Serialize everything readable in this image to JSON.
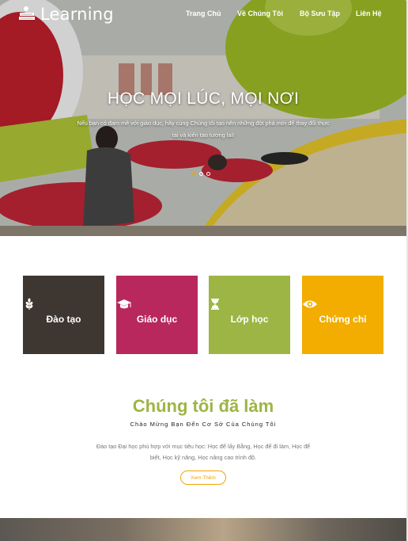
{
  "brand": {
    "name": "Learning"
  },
  "nav": {
    "items": [
      "Trang Chủ",
      "Về Chúng Tôi",
      "Bộ Sưu Tập",
      "Liên Hệ"
    ]
  },
  "hero": {
    "title": "HỌC MỌI LÚC, MỌI NƠI",
    "subtitle_line1": "Nếu bạn có đam mê với giáo dục, hãy cùng Chúng tôi tạo nên những đột phá mới để thay đổi thực",
    "subtitle_line2": "tại và kiến tạo tương lai!",
    "slide_count": 3,
    "active_slide": 1
  },
  "features": [
    {
      "label": "Đào tạo",
      "icon": "wheat-icon",
      "color": "#3e3631"
    },
    {
      "label": "Giáo dục",
      "icon": "graduation-cap-icon",
      "color": "#b8285c"
    },
    {
      "label": "Lớp học",
      "icon": "hourglass-icon",
      "color": "#9db544"
    },
    {
      "label": "Chứng chỉ",
      "icon": "eye-icon",
      "color": "#f2ad00"
    }
  ],
  "about": {
    "title": "Chúng tôi đã làm",
    "subtitle": "Chào Mừng Bạn Đến Cơ Sở Của Chúng Tôi",
    "text_line1": "Đào tạo Đại học phù hợp với mục tiêu học: Học để lấy Bằng, Học để đi làm, Học để",
    "text_line2": "biết, Học kỹ năng, Học nâng cao trình độ.",
    "button": "Xem Thêm"
  },
  "colors": {
    "accent": "#f2a300",
    "green": "#9db544"
  }
}
